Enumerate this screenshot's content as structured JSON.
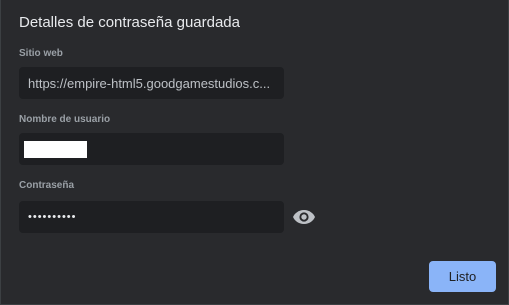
{
  "dialog": {
    "title": "Detalles de contraseña guardada",
    "website": {
      "label": "Sitio web",
      "value": "https://empire-html5.goodgamestudios.c..."
    },
    "username": {
      "label": "Nombre de usuario",
      "value": ""
    },
    "password": {
      "label": "Contraseña",
      "value": "••••••••••"
    },
    "show_password_icon": "eye-icon",
    "done_label": "Listo",
    "accent_color": "#8ab4f8"
  }
}
